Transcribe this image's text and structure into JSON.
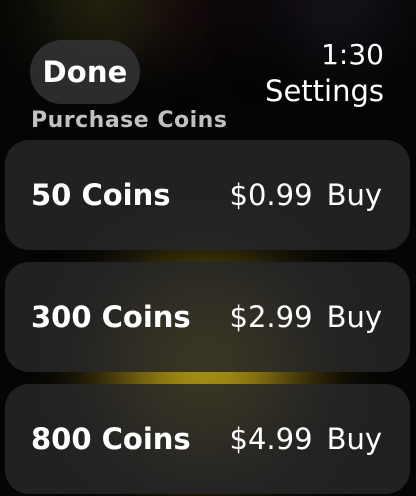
{
  "header": {
    "done_label": "Done",
    "time": "1:30",
    "title": "Settings"
  },
  "section": {
    "label": "Purchase Coins"
  },
  "packages": [
    {
      "quantity": "50 Coins",
      "price": "$0.99",
      "action": "Buy"
    },
    {
      "quantity": "300 Coins",
      "price": "$2.99",
      "action": "Buy"
    },
    {
      "quantity": "800 Coins",
      "price": "$4.99",
      "action": "Buy"
    }
  ],
  "colors": {
    "background": "#000000",
    "row_background": "#262628",
    "done_background": "#37373a",
    "text": "#ffffff",
    "glow": "#e1c81e"
  }
}
